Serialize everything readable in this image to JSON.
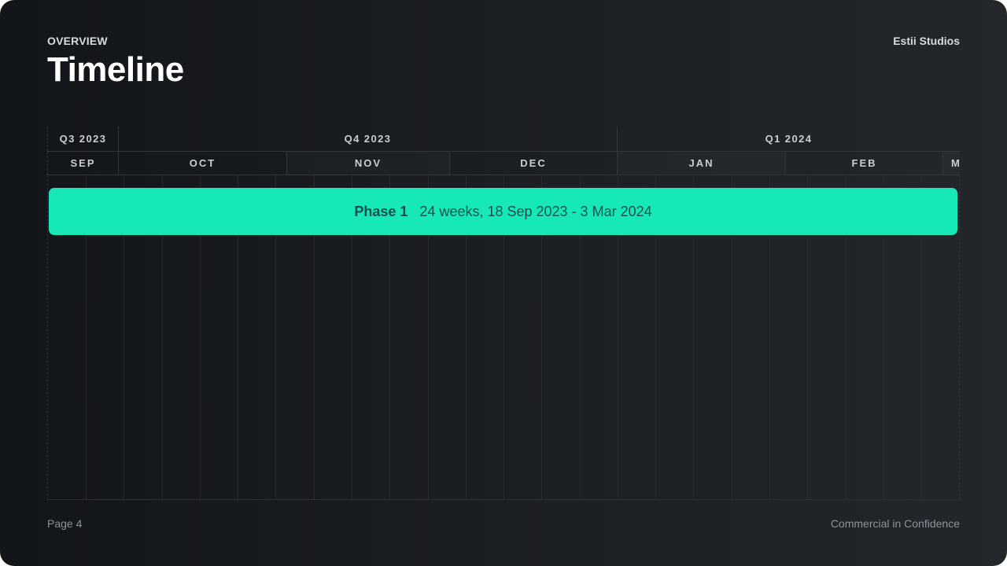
{
  "header": {
    "eyebrow": "OVERVIEW",
    "title": "Timeline",
    "brand": "Estii Studios"
  },
  "timeline": {
    "quarters": [
      "Q3 2023",
      "Q4 2023",
      "Q1 2024"
    ],
    "months": [
      "SEP",
      "OCT",
      "NOV",
      "DEC",
      "JAN",
      "FEB",
      "M"
    ],
    "phases": [
      {
        "label": "Phase 1",
        "detail": "24 weeks, 18 Sep 2023 - 3 Mar 2024",
        "color": "#16e8b6",
        "text_color": "#17504e"
      }
    ]
  },
  "footer": {
    "page": "Page 4",
    "confidentiality": "Commercial in Confidence"
  }
}
